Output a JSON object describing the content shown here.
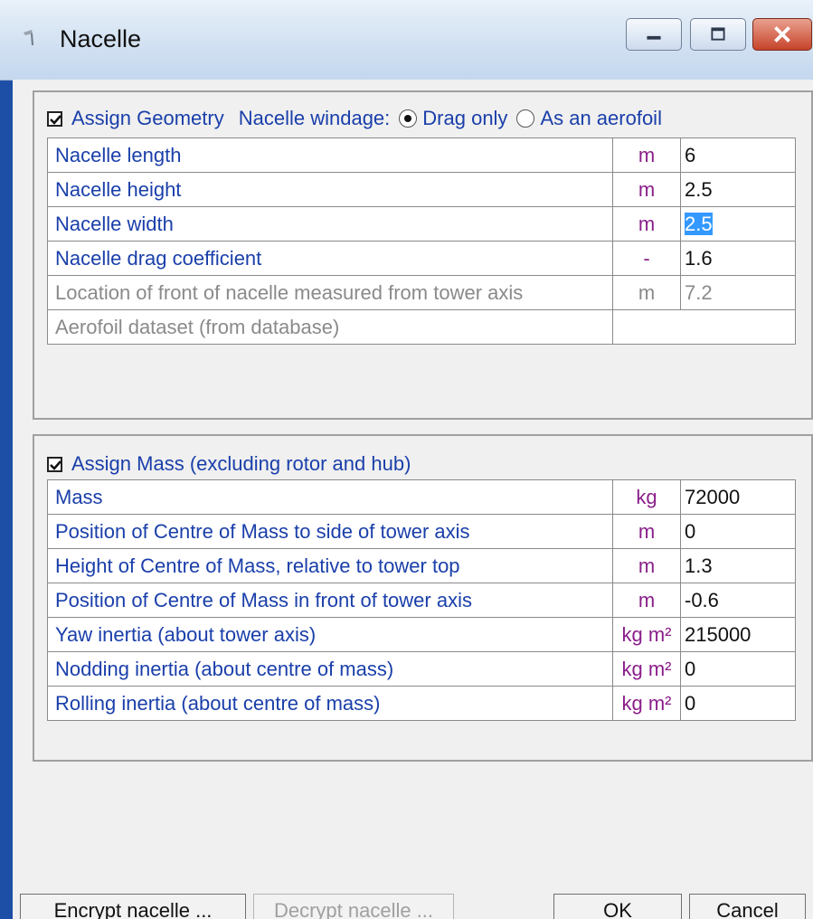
{
  "window": {
    "title": "Nacelle"
  },
  "geometry": {
    "checkbox_label": "Assign Geometry",
    "checked": true,
    "windage_label": "Nacelle windage:",
    "windage_options": [
      "Drag only",
      "As an aerofoil"
    ],
    "windage_selected": "Drag only",
    "rows": [
      {
        "label": "Nacelle length",
        "unit": "m",
        "value": "6"
      },
      {
        "label": "Nacelle height",
        "unit": "m",
        "value": "2.5"
      },
      {
        "label": "Nacelle width",
        "unit": "m",
        "value": "2.5"
      },
      {
        "label": "Nacelle drag coefficient",
        "unit": "-",
        "value": "1.6"
      },
      {
        "label": "Location of front of nacelle measured from tower axis",
        "unit": "m",
        "value": "7.2"
      },
      {
        "label": "Aerofoil dataset (from database)",
        "unit": "",
        "value": ""
      }
    ]
  },
  "mass": {
    "checkbox_label": "Assign Mass (excluding rotor and hub)",
    "checked": true,
    "rows": [
      {
        "label": "Mass",
        "unit": "kg",
        "value": "72000"
      },
      {
        "label": "Position of Centre of Mass to side of tower axis",
        "unit": "m",
        "value": "0"
      },
      {
        "label": "Height of Centre of Mass, relative to tower top",
        "unit": "m",
        "value": "1.3"
      },
      {
        "label": "Position of Centre of Mass in front of tower axis",
        "unit": "m",
        "value": "-0.6"
      },
      {
        "label": "Yaw inertia (about tower axis)",
        "unit": "kg m²",
        "value": "215000"
      },
      {
        "label": "Nodding inertia (about centre of mass)",
        "unit": "kg m²",
        "value": "0"
      },
      {
        "label": "Rolling inertia (about centre of mass)",
        "unit": "kg m²",
        "value": "0"
      }
    ]
  },
  "buttons": {
    "encrypt": "Encrypt nacelle ...",
    "decrypt": "Decrypt nacelle ...",
    "ok": "OK",
    "cancel": "Cancel"
  },
  "colors": {
    "label_text": "#1a3faa",
    "unit_text": "#8a1e8a",
    "selection": "#3399ff",
    "window_frame": "#1d4fa7"
  }
}
